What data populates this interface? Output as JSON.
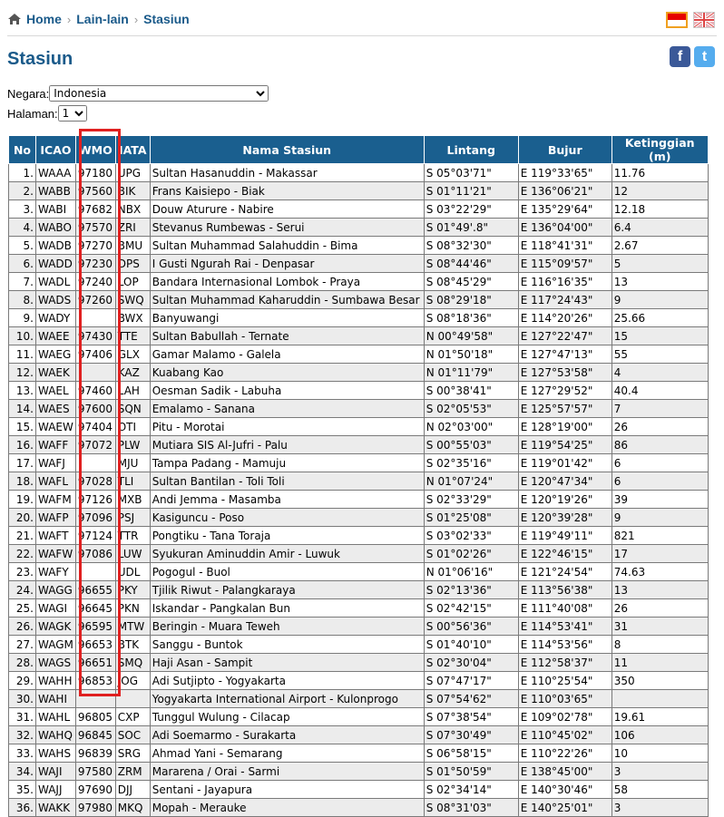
{
  "breadcrumb": {
    "home": "Home",
    "level1": "Lain-lain",
    "level2": "Stasiun"
  },
  "page_title": "Stasiun",
  "filters": {
    "negara_label": "Negara:",
    "negara_value": "Indonesia",
    "halaman_label": "Halaman:",
    "halaman_value": "1"
  },
  "table": {
    "headers": {
      "no": "No",
      "icao": "ICAO",
      "wmo": "WMO",
      "iata": "IATA",
      "nama": "Nama Stasiun",
      "lintang": "Lintang",
      "bujur": "Bujur",
      "ketinggian": "Ketinggian (m)"
    },
    "rows": [
      {
        "no": "1.",
        "icao": "WAAA",
        "wmo": "97180",
        "iata": "UPG",
        "nama": "Sultan Hasanuddin - Makassar",
        "lat": "S 05°03'71\"",
        "lon": "E 119°33'65\"",
        "alt": "11.76"
      },
      {
        "no": "2.",
        "icao": "WABB",
        "wmo": "97560",
        "iata": "BIK",
        "nama": "Frans Kaisiepo - Biak",
        "lat": "S 01°11'21\"",
        "lon": "E 136°06'21\"",
        "alt": "12"
      },
      {
        "no": "3.",
        "icao": "WABI",
        "wmo": "97682",
        "iata": "NBX",
        "nama": "Douw Aturure - Nabire",
        "lat": "S 03°22'29\"",
        "lon": "E 135°29'64\"",
        "alt": "12.18"
      },
      {
        "no": "4.",
        "icao": "WABO",
        "wmo": "97570",
        "iata": "ZRI",
        "nama": "Stevanus Rumbewas - Serui",
        "lat": "S 01°49'.8\"",
        "lon": "E 136°04'00\"",
        "alt": "6.4"
      },
      {
        "no": "5.",
        "icao": "WADB",
        "wmo": "97270",
        "iata": "BMU",
        "nama": "Sultan Muhammad Salahuddin - Bima",
        "lat": "S 08°32'30\"",
        "lon": "E 118°41'31\"",
        "alt": "2.67"
      },
      {
        "no": "6.",
        "icao": "WADD",
        "wmo": "97230",
        "iata": "DPS",
        "nama": "I Gusti Ngurah Rai - Denpasar",
        "lat": "S 08°44'46\"",
        "lon": "E 115°09'57\"",
        "alt": "5"
      },
      {
        "no": "7.",
        "icao": "WADL",
        "wmo": "97240",
        "iata": "LOP",
        "nama": "Bandara Internasional Lombok - Praya",
        "lat": "S 08°45'29\"",
        "lon": "E 116°16'35\"",
        "alt": "13"
      },
      {
        "no": "8.",
        "icao": "WADS",
        "wmo": "97260",
        "iata": "SWQ",
        "nama": "Sultan Muhammad Kaharuddin - Sumbawa Besar",
        "lat": "S 08°29'18\"",
        "lon": "E 117°24'43\"",
        "alt": "9"
      },
      {
        "no": "9.",
        "icao": "WADY",
        "wmo": "",
        "iata": "BWX",
        "nama": "Banyuwangi",
        "lat": "S 08°18'36\"",
        "lon": "E 114°20'26\"",
        "alt": "25.66"
      },
      {
        "no": "10.",
        "icao": "WAEE",
        "wmo": "97430",
        "iata": "TTE",
        "nama": "Sultan Babullah - Ternate",
        "lat": "N 00°49'58\"",
        "lon": "E 127°22'47\"",
        "alt": "15"
      },
      {
        "no": "11.",
        "icao": "WAEG",
        "wmo": "97406",
        "iata": "GLX",
        "nama": "Gamar Malamo - Galela",
        "lat": "N 01°50'18\"",
        "lon": "E 127°47'13\"",
        "alt": "55"
      },
      {
        "no": "12.",
        "icao": "WAEK",
        "wmo": "",
        "iata": "KAZ",
        "nama": "Kuabang Kao",
        "lat": "N 01°11'79\"",
        "lon": "E 127°53'58\"",
        "alt": "4"
      },
      {
        "no": "13.",
        "icao": "WAEL",
        "wmo": "97460",
        "iata": "LAH",
        "nama": "Oesman Sadik - Labuha",
        "lat": "S 00°38'41\"",
        "lon": "E 127°29'52\"",
        "alt": "40.4"
      },
      {
        "no": "14.",
        "icao": "WAES",
        "wmo": "97600",
        "iata": "SQN",
        "nama": "Emalamo - Sanana",
        "lat": "S 02°05'53\"",
        "lon": "E 125°57'57\"",
        "alt": "7"
      },
      {
        "no": "15.",
        "icao": "WAEW",
        "wmo": "97404",
        "iata": "OTI",
        "nama": "Pitu - Morotai",
        "lat": "N 02°03'00\"",
        "lon": "E 128°19'00\"",
        "alt": "26"
      },
      {
        "no": "16.",
        "icao": "WAFF",
        "wmo": "97072",
        "iata": "PLW",
        "nama": "Mutiara SIS Al-Jufri - Palu",
        "lat": "S 00°55'03\"",
        "lon": "E 119°54'25\"",
        "alt": "86"
      },
      {
        "no": "17.",
        "icao": "WAFJ",
        "wmo": "",
        "iata": "MJU",
        "nama": "Tampa Padang - Mamuju",
        "lat": "S 02°35'16\"",
        "lon": "E 119°01'42\"",
        "alt": "6"
      },
      {
        "no": "18.",
        "icao": "WAFL",
        "wmo": "97028",
        "iata": "TLI",
        "nama": "Sultan Bantilan - Toli Toli",
        "lat": "N 01°07'24\"",
        "lon": "E 120°47'34\"",
        "alt": "6"
      },
      {
        "no": "19.",
        "icao": "WAFM",
        "wmo": "97126",
        "iata": "MXB",
        "nama": "Andi Jemma - Masamba",
        "lat": "S 02°33'29\"",
        "lon": "E 120°19'26\"",
        "alt": "39"
      },
      {
        "no": "20.",
        "icao": "WAFP",
        "wmo": "97096",
        "iata": "PSJ",
        "nama": "Kasiguncu - Poso",
        "lat": "S 01°25'08\"",
        "lon": "E 120°39'28\"",
        "alt": "9"
      },
      {
        "no": "21.",
        "icao": "WAFT",
        "wmo": "97124",
        "iata": "TTR",
        "nama": "Pongtiku - Tana Toraja",
        "lat": "S 03°02'33\"",
        "lon": "E 119°49'11\"",
        "alt": "821"
      },
      {
        "no": "22.",
        "icao": "WAFW",
        "wmo": "97086",
        "iata": "LUW",
        "nama": "Syukuran Aminuddin Amir - Luwuk",
        "lat": "S 01°02'26\"",
        "lon": "E 122°46'15\"",
        "alt": "17"
      },
      {
        "no": "23.",
        "icao": "WAFY",
        "wmo": "",
        "iata": "UDL",
        "nama": "Pogogul - Buol",
        "lat": "N 01°06'16\"",
        "lon": "E 121°24'54\"",
        "alt": "74.63"
      },
      {
        "no": "24.",
        "icao": "WAGG",
        "wmo": "96655",
        "iata": "PKY",
        "nama": "Tjilik Riwut - Palangkaraya",
        "lat": "S 02°13'36\"",
        "lon": "E 113°56'38\"",
        "alt": "13"
      },
      {
        "no": "25.",
        "icao": "WAGI",
        "wmo": "96645",
        "iata": "PKN",
        "nama": "Iskandar - Pangkalan Bun",
        "lat": "S 02°42'15\"",
        "lon": "E 111°40'08\"",
        "alt": "26"
      },
      {
        "no": "26.",
        "icao": "WAGK",
        "wmo": "96595",
        "iata": "MTW",
        "nama": "Beringin - Muara Teweh",
        "lat": "S 00°56'36\"",
        "lon": "E 114°53'41\"",
        "alt": "31"
      },
      {
        "no": "27.",
        "icao": "WAGM",
        "wmo": "96653",
        "iata": "BTK",
        "nama": "Sanggu - Buntok",
        "lat": "S 01°40'10\"",
        "lon": "E 114°53'56\"",
        "alt": "8"
      },
      {
        "no": "28.",
        "icao": "WAGS",
        "wmo": "96651",
        "iata": "SMQ",
        "nama": "Haji Asan - Sampit",
        "lat": "S 02°30'04\"",
        "lon": "E 112°58'37\"",
        "alt": "11"
      },
      {
        "no": "29.",
        "icao": "WAHH",
        "wmo": "96853",
        "iata": "JOG",
        "nama": "Adi Sutjipto - Yogyakarta",
        "lat": "S 07°47'17\"",
        "lon": "E 110°25'54\"",
        "alt": "350"
      },
      {
        "no": "30.",
        "icao": "WAHI",
        "wmo": "",
        "iata": "",
        "nama": "Yogyakarta International Airport - Kulonprogo",
        "lat": "S 07°54'62\"",
        "lon": "E 110°03'65\"",
        "alt": ""
      },
      {
        "no": "31.",
        "icao": "WAHL",
        "wmo": "96805",
        "iata": "CXP",
        "nama": "Tunggul Wulung - Cilacap",
        "lat": "S 07°38'54\"",
        "lon": "E 109°02'78\"",
        "alt": "19.61"
      },
      {
        "no": "32.",
        "icao": "WAHQ",
        "wmo": "96845",
        "iata": "SOC",
        "nama": "Adi Soemarmo - Surakarta",
        "lat": "S 07°30'49\"",
        "lon": "E 110°45'02\"",
        "alt": "106"
      },
      {
        "no": "33.",
        "icao": "WAHS",
        "wmo": "96839",
        "iata": "SRG",
        "nama": "Ahmad Yani - Semarang",
        "lat": "S 06°58'15\"",
        "lon": "E 110°22'26\"",
        "alt": "10"
      },
      {
        "no": "34.",
        "icao": "WAJI",
        "wmo": "97580",
        "iata": "ZRM",
        "nama": "Mararena / Orai - Sarmi",
        "lat": "S 01°50'59\"",
        "lon": "E 138°45'00\"",
        "alt": "3"
      },
      {
        "no": "35.",
        "icao": "WAJJ",
        "wmo": "97690",
        "iata": "DJJ",
        "nama": "Sentani - Jayapura",
        "lat": "S 02°34'14\"",
        "lon": "E 140°30'46\"",
        "alt": "58"
      },
      {
        "no": "36.",
        "icao": "WAKK",
        "wmo": "97980",
        "iata": "MKQ",
        "nama": "Mopah - Merauke",
        "lat": "S 08°31'03\"",
        "lon": "E 140°25'01\"",
        "alt": "3"
      }
    ]
  }
}
